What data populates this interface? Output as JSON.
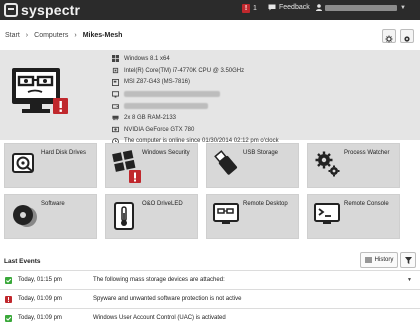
{
  "app": {
    "name": "syspectr"
  },
  "topbar": {
    "notification_count": "1",
    "feedback_label": "Feedback"
  },
  "breadcrumb": {
    "items": [
      "Start",
      "Computers"
    ],
    "current": "Mikes-Mesh"
  },
  "computer": {
    "specs": [
      {
        "icon": "windows-icon",
        "text": "Windows 8.1 x64"
      },
      {
        "icon": "cpu-icon",
        "text": "Intel(R) Core(TM) i7-4770K CPU @ 3.50GHz"
      },
      {
        "icon": "motherboard-icon",
        "text": "MSI Z87-G43 (MS-7816)"
      },
      {
        "icon": "monitor-icon",
        "text": ""
      },
      {
        "icon": "drive-icon",
        "text": ""
      },
      {
        "icon": "ram-icon",
        "text": "2x 8 GB RAM-2133"
      },
      {
        "icon": "gpu-icon",
        "text": "NVIDIA GeForce GTX 780"
      },
      {
        "icon": "clock-icon",
        "text": "The computer is online since 01/30/2014 02:12 pm o'clock"
      }
    ]
  },
  "tiles": [
    {
      "name": "hard-disk-drives",
      "label": "Hard Disk Drives",
      "icon": "hard-disk-icon",
      "alert": false
    },
    {
      "name": "windows-security",
      "label": "Windows Security",
      "icon": "windows-security-icon",
      "alert": true
    },
    {
      "name": "usb-storage",
      "label": "USB Storage",
      "icon": "usb-icon",
      "alert": false
    },
    {
      "name": "process-watcher",
      "label": "Process Watcher",
      "icon": "gears-icon",
      "alert": false
    },
    {
      "name": "software",
      "label": "Software",
      "icon": "disc-icon",
      "alert": false
    },
    {
      "name": "oo-driveled",
      "label": "O&O DriveLED",
      "icon": "thermometer-icon",
      "alert": false
    },
    {
      "name": "remote-desktop",
      "label": "Remote Desktop",
      "icon": "remote-desktop-icon",
      "alert": false
    },
    {
      "name": "remote-console",
      "label": "Remote Console",
      "icon": "console-icon",
      "alert": false
    }
  ],
  "events": {
    "title": "Last Events",
    "history_label": "History",
    "items": [
      {
        "status": "ok",
        "time": "Today, 01:15 pm",
        "message": "The following mass storage devices are attached:"
      },
      {
        "status": "error",
        "time": "Today, 01:09 pm",
        "message": "Spyware and unwanted software protection is not active"
      },
      {
        "status": "ok",
        "time": "Today, 01:09 pm",
        "message": "Windows User Account Control (UAC) is activated"
      }
    ]
  },
  "colors": {
    "topbar": "#2b2b2b",
    "alert_red": "#c0282d",
    "ok_green": "#3aa83a",
    "panel_gray": "#e5e5e5",
    "tile_gray": "#d8d8d8"
  }
}
